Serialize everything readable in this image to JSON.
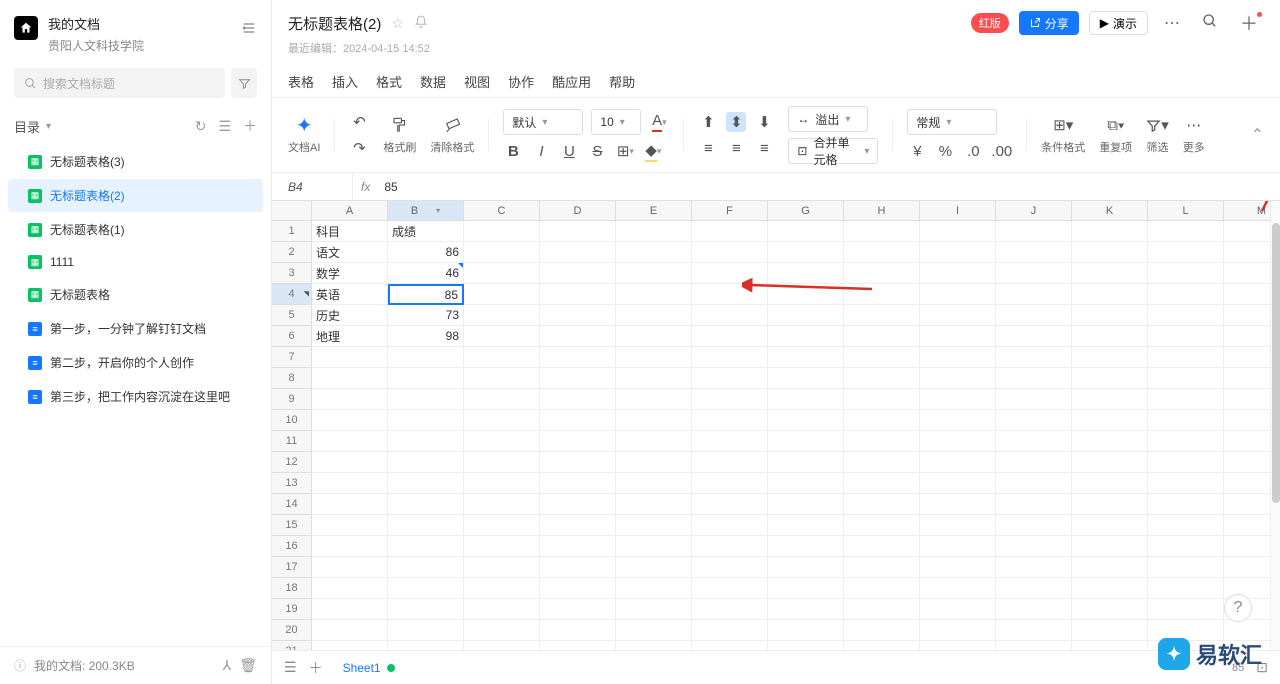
{
  "sidebar": {
    "title": "我的文档",
    "subtitle": "贵阳人文科技学院",
    "search_placeholder": "搜索文档标题",
    "catalog_label": "目录",
    "items": [
      {
        "type": "sheet",
        "label": "无标题表格(3)"
      },
      {
        "type": "sheet",
        "label": "无标题表格(2)",
        "active": true
      },
      {
        "type": "sheet",
        "label": "无标题表格(1)"
      },
      {
        "type": "sheet",
        "label": "1111"
      },
      {
        "type": "sheet",
        "label": "无标题表格"
      },
      {
        "type": "doc",
        "label": "第一步，一分钟了解钉钉文档"
      },
      {
        "type": "doc",
        "label": "第二步，开启你的个人创作"
      },
      {
        "type": "doc",
        "label": "第三步，把工作内容沉淀在这里吧"
      }
    ],
    "footer_text": "我的文档: 200.3KB"
  },
  "header": {
    "title": "无标题表格(2)",
    "edit_time_label": "最近编辑：",
    "edit_time": "2024-04-15 14:52",
    "badge": "红版",
    "share": "分享",
    "play": "演示"
  },
  "menus": [
    "表格",
    "插入",
    "格式",
    "数据",
    "视图",
    "协作",
    "酷应用",
    "帮助"
  ],
  "toolbar": {
    "ai": "文档AI",
    "format_painter": "格式刷",
    "clear_format": "清除格式",
    "font": "默认",
    "size": "10",
    "overflow": "溢出",
    "merge": "合并单元格",
    "number_format": "常规",
    "cond_format": "条件格式",
    "duplicates": "重复项",
    "filter": "筛选",
    "more": "更多"
  },
  "formula": {
    "ref": "B4",
    "value": "85"
  },
  "columns": [
    "A",
    "B",
    "C",
    "D",
    "E",
    "F",
    "G",
    "H",
    "I",
    "J",
    "K",
    "L",
    "M"
  ],
  "rows_count": 22,
  "selected": {
    "row": 4,
    "col": "B"
  },
  "chart_data": {
    "type": "table",
    "headers": [
      "科目",
      "成绩"
    ],
    "rows": [
      [
        "语文",
        86
      ],
      [
        "数学",
        46
      ],
      [
        "英语",
        85
      ],
      [
        "历史",
        73
      ],
      [
        "地理",
        98
      ]
    ]
  },
  "sheet_tabs": {
    "name": "Sheet1"
  },
  "status": {
    "value": "85"
  },
  "watermark": "易软汇"
}
